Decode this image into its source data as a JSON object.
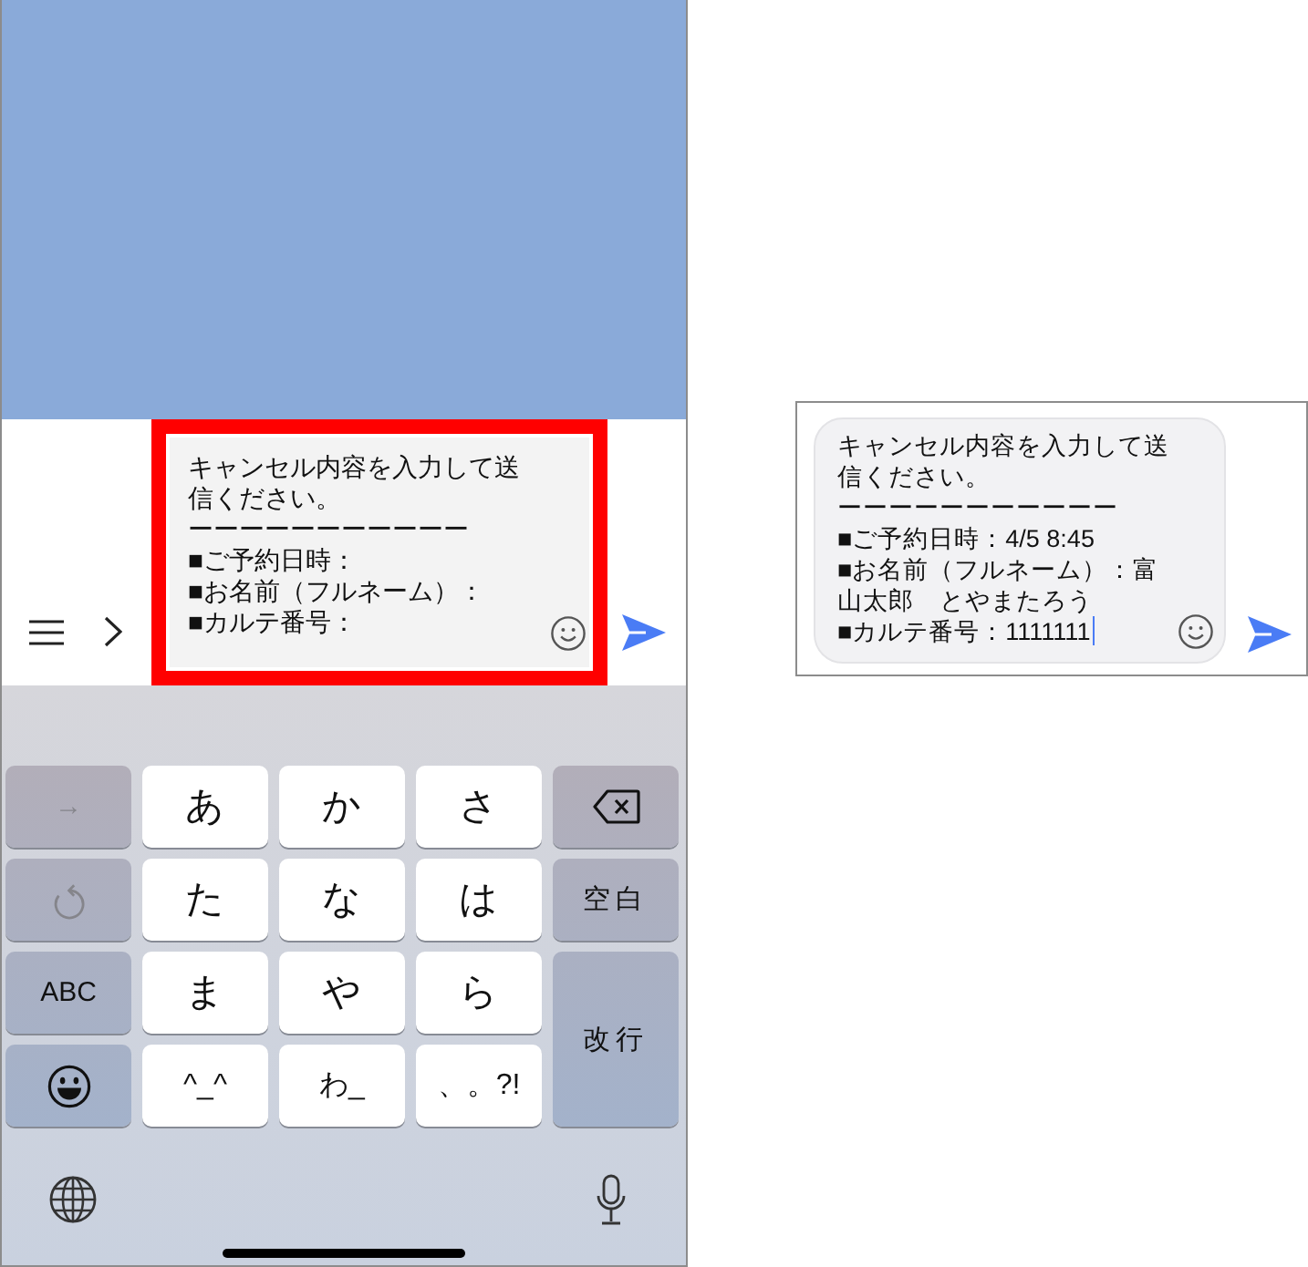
{
  "phone": {
    "message_field": {
      "lines": [
        "キャンセル内容を入力して送信ください。",
        "ーーーーーーーーーーー",
        "■ご予約日時：",
        "■お名前（フルネーム）：",
        "■カルテ番号："
      ],
      "highlighted": true,
      "focused": false
    },
    "keyboard": {
      "keys": [
        {
          "kind": "function",
          "label": "→",
          "disabled": true
        },
        {
          "kind": "char",
          "label": "あ",
          "disabled": false
        },
        {
          "kind": "char",
          "label": "か",
          "disabled": false
        },
        {
          "kind": "char",
          "label": "さ",
          "disabled": false
        },
        {
          "kind": "delete",
          "disabled": false
        },
        {
          "kind": "undo",
          "disabled": true
        },
        {
          "kind": "char",
          "label": "た",
          "disabled": false
        },
        {
          "kind": "char",
          "label": "な",
          "disabled": false
        },
        {
          "kind": "char",
          "label": "は",
          "disabled": false
        },
        {
          "kind": "function",
          "label": "空白",
          "disabled": false
        },
        {
          "kind": "function",
          "label": "ABC",
          "disabled": false
        },
        {
          "kind": "char",
          "label": "ま",
          "disabled": false
        },
        {
          "kind": "char",
          "label": "や",
          "disabled": false
        },
        {
          "kind": "char",
          "label": "ら",
          "disabled": false
        },
        {
          "kind": "return",
          "label": "改行",
          "disabled": false
        },
        {
          "kind": "emoji",
          "disabled": false
        },
        {
          "kind": "char",
          "label": "^_^",
          "disabled": false
        },
        {
          "kind": "char",
          "label": "わ_",
          "disabled": false
        },
        {
          "kind": "char",
          "label": "、。?!",
          "disabled": false
        }
      ]
    }
  },
  "preview": {
    "message_field": {
      "lines": [
        "キャンセル内容を入力して送信ください。",
        "ーーーーーーーーーーー",
        "■ご予約日時：4/5 8:45",
        "■お名前（フルネーム）：富山太郎　とやまたろう",
        "■カルテ番号：1111111"
      ],
      "highlighted": false,
      "focused": true
    }
  }
}
